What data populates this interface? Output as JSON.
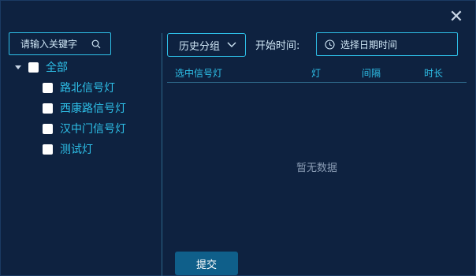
{
  "dialog": {
    "close_icon": "close-icon"
  },
  "search": {
    "placeholder": "请输入关键字",
    "icon": "search-icon"
  },
  "tree": {
    "root": {
      "label": "全部",
      "checked": false,
      "expanded": true
    },
    "items": [
      {
        "label": "路北信号灯",
        "checked": false
      },
      {
        "label": "西康路信号灯",
        "checked": false
      },
      {
        "label": "汉中门信号灯",
        "checked": false
      },
      {
        "label": "测试灯",
        "checked": false
      }
    ]
  },
  "toolbar": {
    "group_select": "历史分组",
    "start_time_label": "开始时间:",
    "date_placeholder": "选择日期时间"
  },
  "table": {
    "columns": [
      "选中信号灯",
      "灯",
      "间隔",
      "时长"
    ],
    "empty_text": "暂无数据"
  },
  "submit_label": "提交",
  "colors": {
    "accent": "#2ec0e8",
    "panel": "#0e2240",
    "button": "#0f5f8a"
  }
}
